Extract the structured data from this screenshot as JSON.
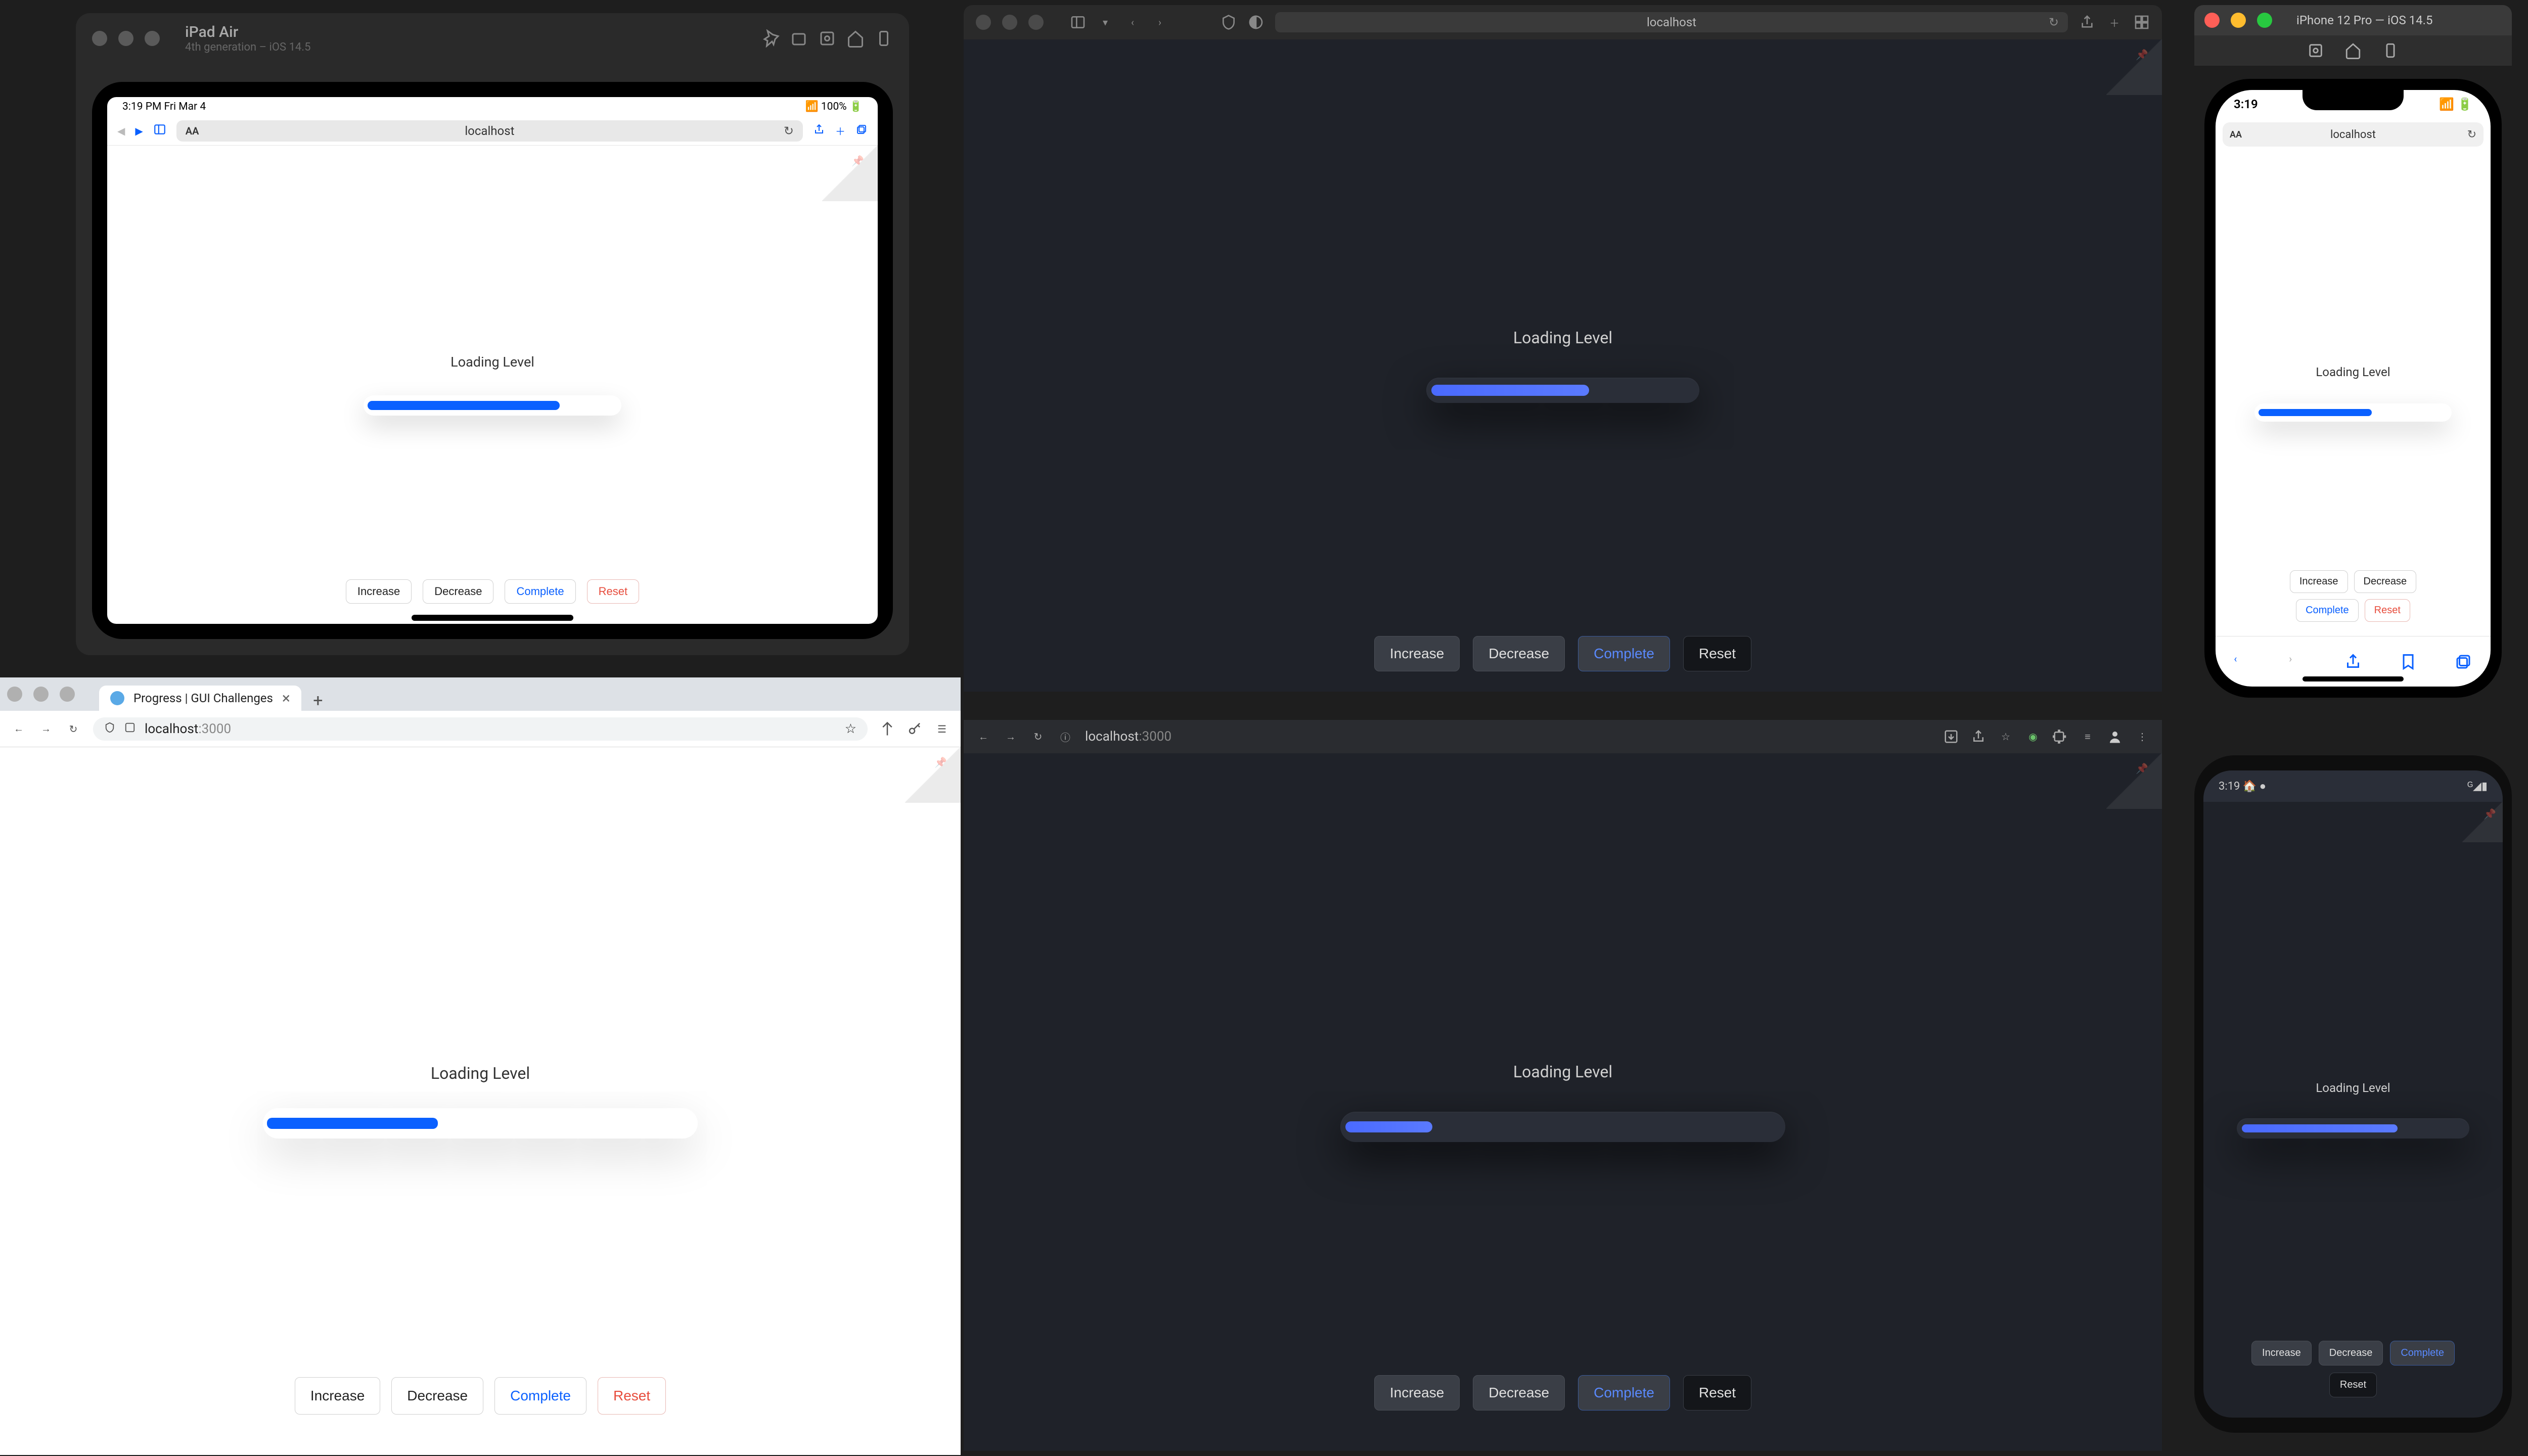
{
  "shared": {
    "loading_label": "Loading Level",
    "buttons": {
      "increase": "Increase",
      "decrease": "Decrease",
      "complete": "Complete",
      "reset": "Reset"
    }
  },
  "ipad": {
    "sim_title": "iPad Air",
    "sim_sub": "4th generation – iOS 14.5",
    "status_time": "3:19 PM  Fri Mar 4",
    "status_right": "100%",
    "url": "localhost",
    "aa": "AA",
    "progress_pct": 77
  },
  "safari": {
    "url": "localhost",
    "progress_pct": 60
  },
  "chrome_light": {
    "tab_title": "Progress | GUI Challenges",
    "url_main": "localhost",
    "url_port": ":3000",
    "progress_pct": 40
  },
  "chrome_dark": {
    "url_main": "localhost",
    "url_port": ":3000",
    "progress_pct": 20
  },
  "iphone": {
    "sim_title": "iPhone 12 Pro — iOS 14.5",
    "status_time": "3:19",
    "url": "localhost",
    "aa": "AA",
    "progress_pct": 60
  },
  "android": {
    "status_time": "3:19",
    "progress_pct": 70
  }
}
